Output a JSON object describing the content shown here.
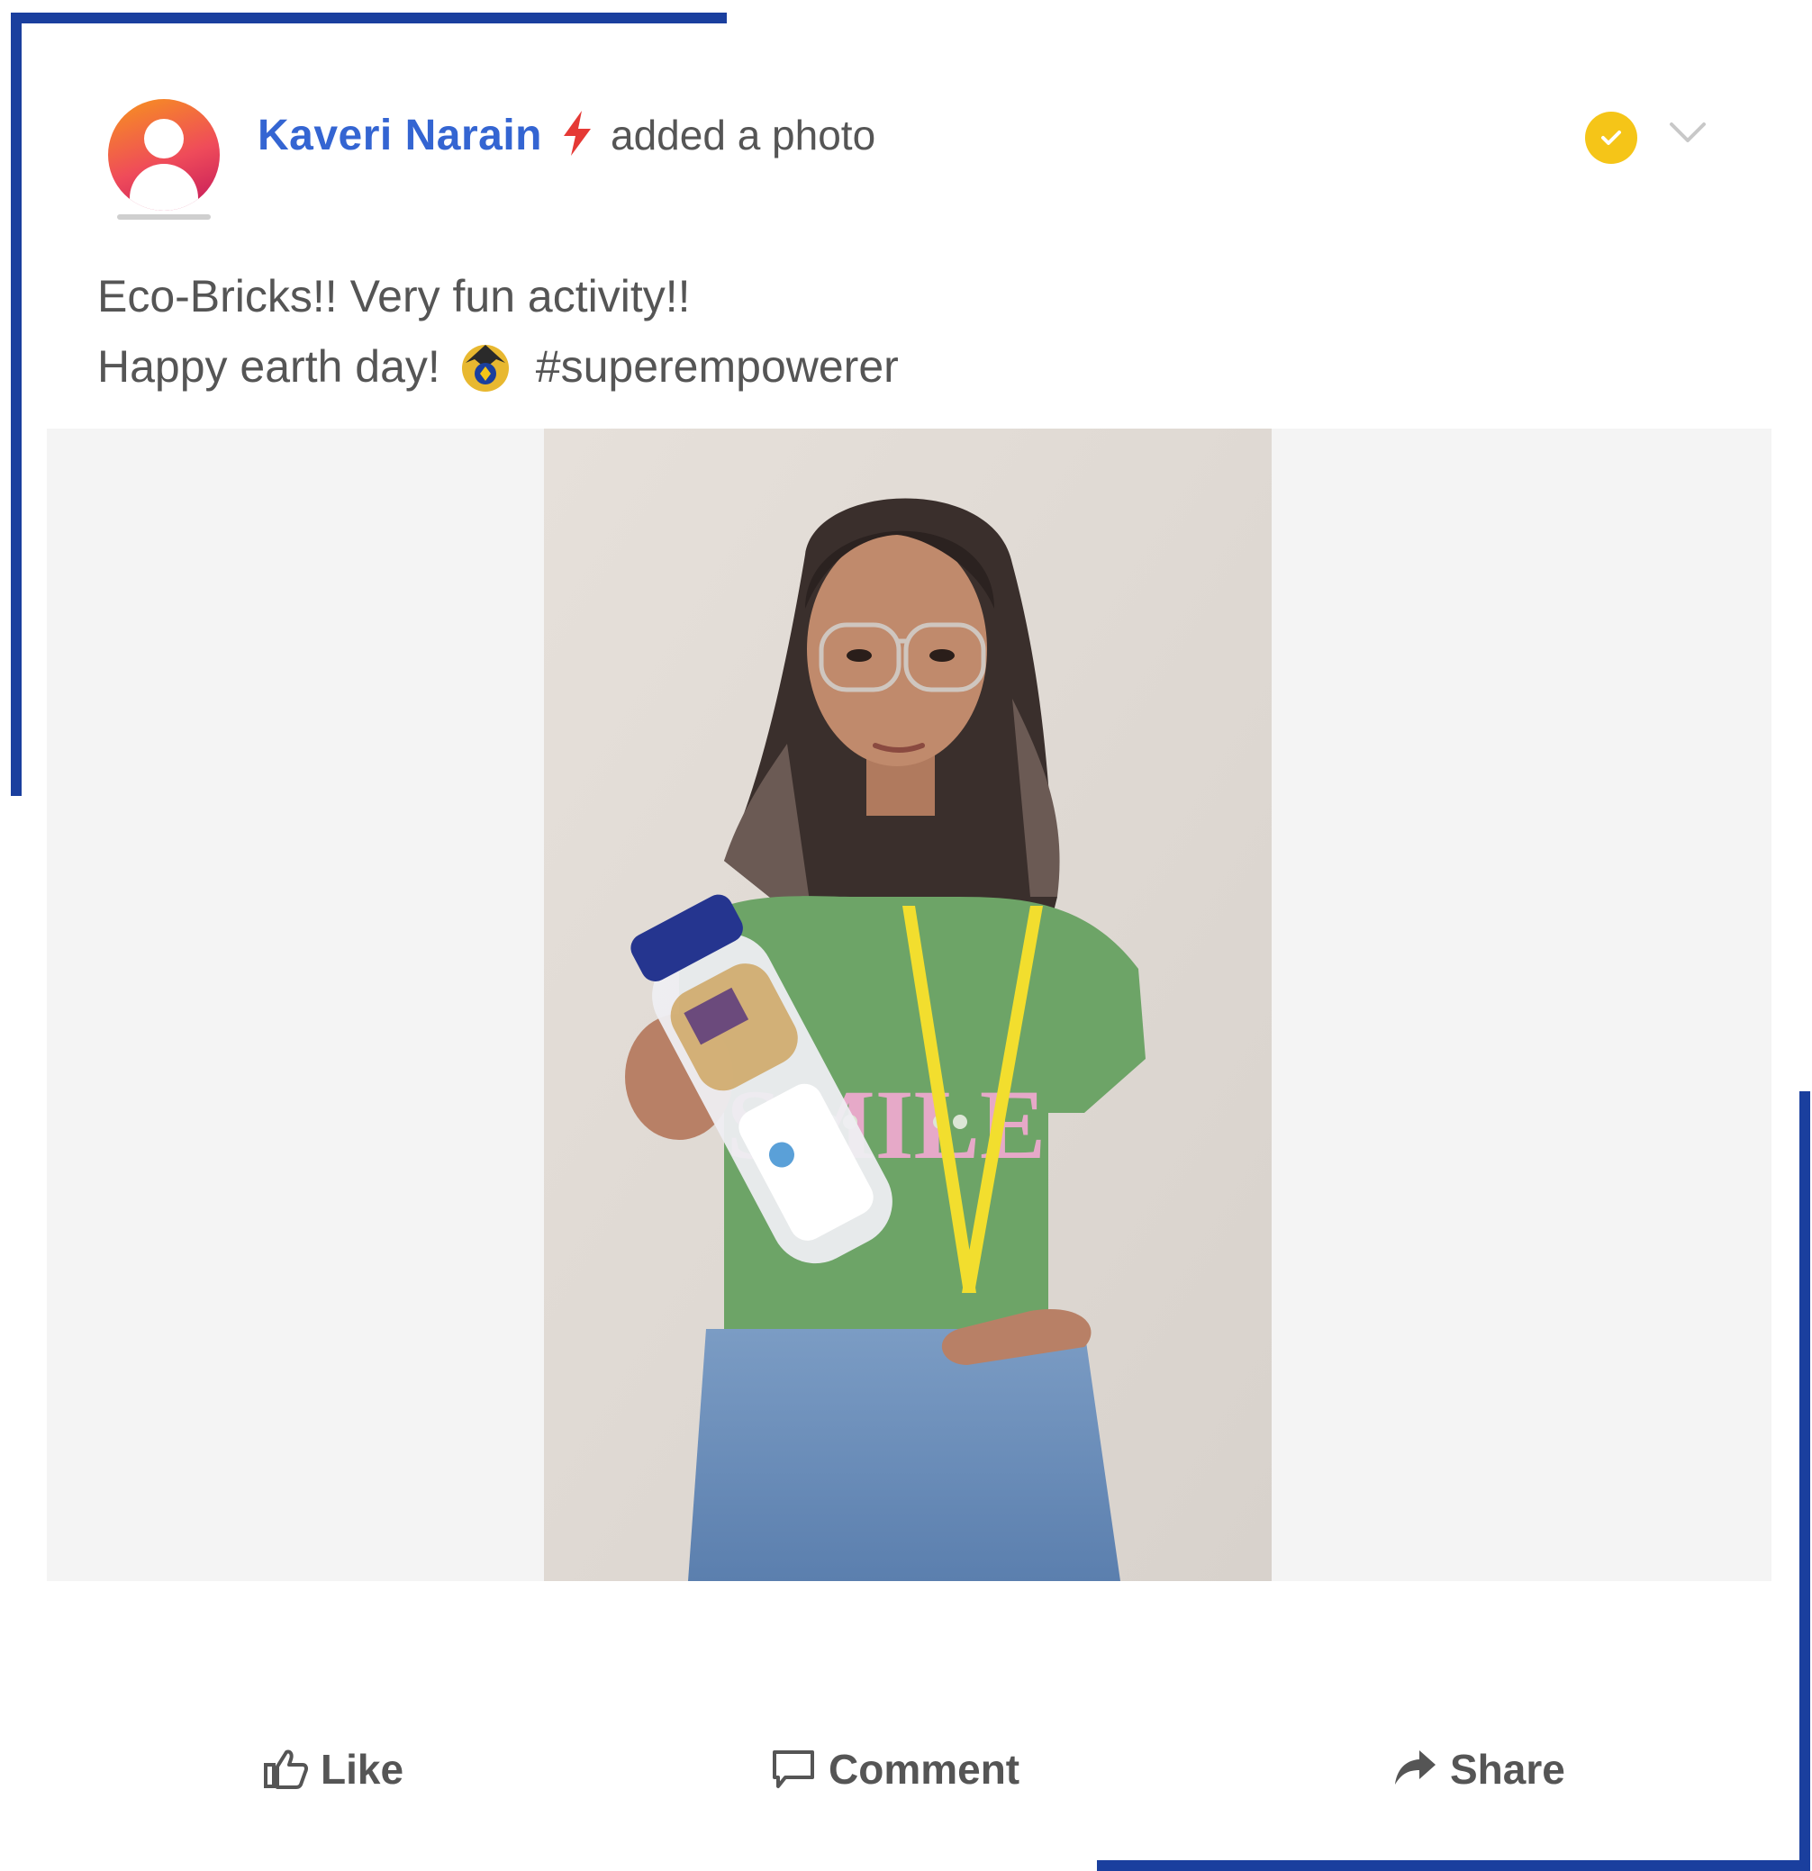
{
  "post": {
    "author": "Kaveri Narain",
    "action": "added a photo",
    "caption_line1": "Eco-Bricks!! Very fun activity!!",
    "caption_line2_text": "Happy earth day!",
    "caption_hashtag": "#superempowerer",
    "author_badge_icon": "lightning-bolt-icon",
    "status_icon": "verified-check-icon",
    "menu_icon": "chevron-down-icon",
    "caption_emoji_icon": "badge-emoji-icon"
  },
  "actions": {
    "like_label": "Like",
    "comment_label": "Comment",
    "share_label": "Share"
  },
  "colors": {
    "brand_blue": "#1a3f9e",
    "author_blue": "#3465d2",
    "verified_yellow": "#f5c518",
    "bolt_red": "#e53935",
    "text_gray": "#555555"
  }
}
